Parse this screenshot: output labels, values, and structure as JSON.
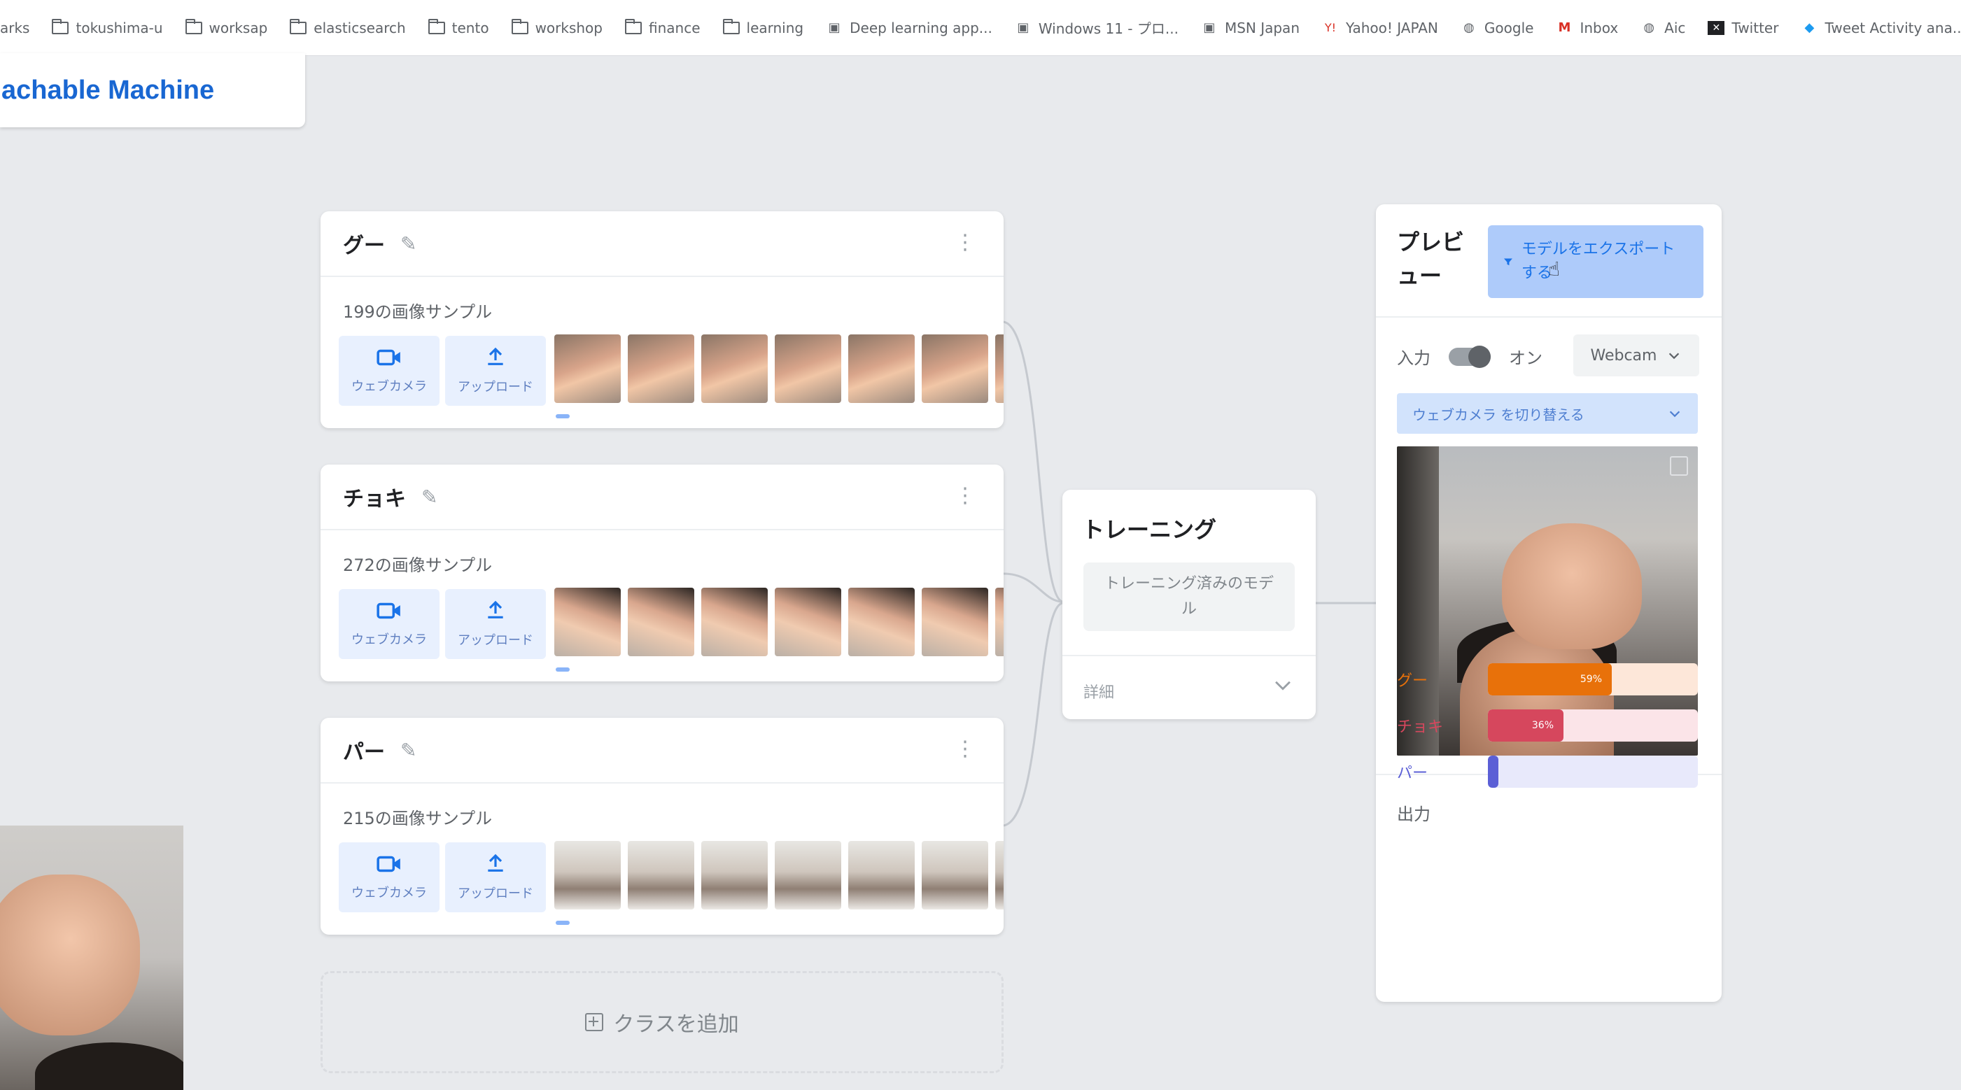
{
  "bookmarks": [
    {
      "label": "arks",
      "icon": "none"
    },
    {
      "label": "tokushima-u",
      "icon": "folder-icon"
    },
    {
      "label": "worksap",
      "icon": "folder-icon"
    },
    {
      "label": "elasticsearch",
      "icon": "folder-icon"
    },
    {
      "label": "tento",
      "icon": "folder-icon"
    },
    {
      "label": "workshop",
      "icon": "folder-icon"
    },
    {
      "label": "finance",
      "icon": "folder-icon"
    },
    {
      "label": "learning",
      "icon": "folder-icon"
    },
    {
      "label": "Deep learning app...",
      "icon": "site-icon"
    },
    {
      "label": "Windows 11 - プロ...",
      "icon": "site-icon"
    },
    {
      "label": "MSN Japan",
      "icon": "site-icon"
    },
    {
      "label": "Yahoo! JAPAN",
      "icon": "yahoo-icon"
    },
    {
      "label": "Google",
      "icon": "globe-icon"
    },
    {
      "label": "Inbox",
      "icon": "gmail-icon"
    },
    {
      "label": "Aic",
      "icon": "globe-icon"
    },
    {
      "label": "Twitter",
      "icon": "x-icon"
    },
    {
      "label": "Tweet Activity ana...",
      "icon": "twitter-icon"
    }
  ],
  "app": {
    "title": "achable Machine"
  },
  "classes": [
    {
      "name": "グー",
      "samples": "199の画像サンプル",
      "webcam_label": "ウェブカメラ",
      "upload_label": "アップロード",
      "thumb_style": "gu"
    },
    {
      "name": "チョキ",
      "samples": "272の画像サンプル",
      "webcam_label": "ウェブカメラ",
      "upload_label": "アップロード",
      "thumb_style": "choki"
    },
    {
      "name": "パー",
      "samples": "215の画像サンプル",
      "webcam_label": "ウェブカメラ",
      "upload_label": "アップロード",
      "thumb_style": "pa"
    }
  ],
  "add_class_label": "クラスを追加",
  "training": {
    "title": "トレーニング",
    "button": "トレーニング済みのモデル",
    "advanced": "詳細"
  },
  "preview": {
    "title": "プレビュー",
    "export_button": "モデルをエクスポートする",
    "input_label": "入力",
    "toggle_state": "オン",
    "source": "Webcam",
    "switch_camera": "ウェブカメラ を切り替える",
    "output_label": "出力",
    "outputs": [
      {
        "name": "グー",
        "percent": 59,
        "label": "59%",
        "color": "#e8710a",
        "bg": "#fde7d9"
      },
      {
        "name": "チョキ",
        "percent": 36,
        "label": "36%",
        "color": "#d6475d",
        "bg": "#fbe4e8"
      },
      {
        "name": "パー",
        "percent": 5,
        "label": "",
        "color": "#5b5fd6",
        "bg": "#e8e9fb"
      }
    ]
  }
}
